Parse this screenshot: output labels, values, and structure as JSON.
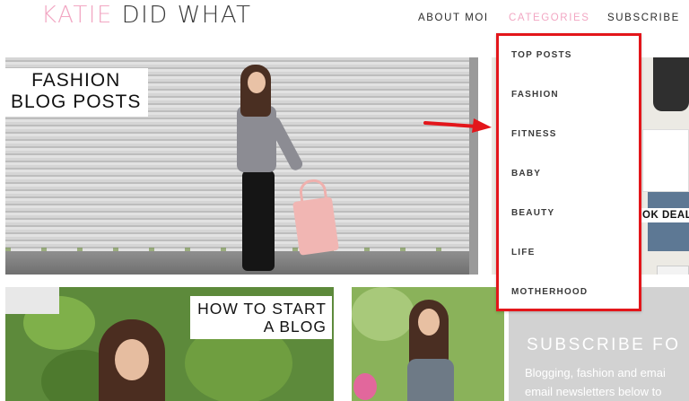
{
  "logo": {
    "part1": "KATIE",
    "part2": "DID WHAT"
  },
  "nav": {
    "about": "ABOUT MOI",
    "categories": "CATEGORIES",
    "subscribe": "SUBSCRIBE"
  },
  "hero": {
    "title_line1": "FASHION",
    "title_line2": "BLOG POSTS"
  },
  "side_photo": {
    "label": "OK DEALS"
  },
  "blog_card": {
    "title_line1": "HOW TO START",
    "title_line2": "A BLOG"
  },
  "subscribe": {
    "title": "SUBSCRIBE FO",
    "text_line1": "Blogging, fashion and emai",
    "text_line2": "email newsletters below to"
  },
  "dropdown": {
    "items": [
      "TOP POSTS",
      "FASHION",
      "FITNESS",
      "BABY",
      "BEAUTY",
      "LIFE",
      "MOTHERHOOD"
    ]
  },
  "colors": {
    "accent_pink": "#f2a7c3",
    "highlight_red": "#e3161b"
  }
}
